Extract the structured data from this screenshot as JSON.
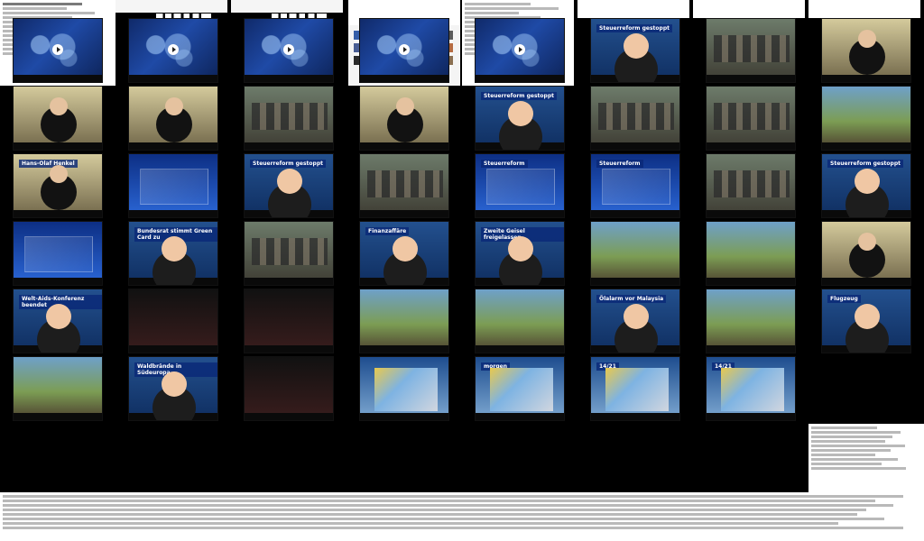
{
  "app": {
    "title": ""
  },
  "screen_panels": {
    "top_left_text": "",
    "top_mid_text": "",
    "top_right_text": "",
    "bottom_text": ""
  },
  "thumbnails": {
    "r1": [
      {
        "label": "",
        "type": "map"
      },
      {
        "label": "",
        "type": "map"
      },
      {
        "label": "",
        "type": "map"
      },
      {
        "label": "",
        "type": "map"
      },
      {
        "label": "",
        "type": "map"
      },
      {
        "label": "Steuerreform gestoppt",
        "type": "anchor"
      },
      {
        "label": "",
        "type": "meeting"
      },
      {
        "label": "",
        "type": "speaker"
      }
    ],
    "r2": [
      {
        "label": "",
        "type": "speaker"
      },
      {
        "label": "",
        "type": "speaker"
      },
      {
        "label": "",
        "type": "meeting"
      },
      {
        "label": "",
        "type": "speaker"
      },
      {
        "label": "Steuerreform gestoppt",
        "type": "anchor"
      },
      {
        "label": "",
        "type": "meeting"
      },
      {
        "label": "",
        "type": "meeting"
      },
      {
        "label": "",
        "type": "outdoor"
      }
    ],
    "r3": [
      {
        "label": "Hans-Olaf Henkel",
        "type": "speaker"
      },
      {
        "label": "",
        "type": "graphic"
      },
      {
        "label": "Steuerreform gestoppt",
        "type": "anchor"
      },
      {
        "label": "",
        "type": "meeting"
      },
      {
        "label": "Steuerreform",
        "type": "graphic"
      },
      {
        "label": "Steuerreform",
        "type": "graphic"
      },
      {
        "label": "",
        "type": "meeting"
      },
      {
        "label": "Steuerreform gestoppt",
        "type": "anchor"
      }
    ],
    "r4": [
      {
        "label": "",
        "type": "graphic"
      },
      {
        "label": "Bundesrat stimmt Green Card zu",
        "type": "anchor"
      },
      {
        "label": "",
        "type": "meeting"
      },
      {
        "label": "Finanzaffäre",
        "type": "anchor"
      },
      {
        "label": "Zweite Geisel freigelassen",
        "type": "anchor"
      },
      {
        "label": "",
        "type": "outdoor"
      },
      {
        "label": "",
        "type": "outdoor"
      },
      {
        "label": "",
        "type": "speaker"
      }
    ],
    "r5": [
      {
        "label": "Welt-Aids-Konferenz beendet",
        "type": "anchor"
      },
      {
        "label": "",
        "type": "dark"
      },
      {
        "label": "",
        "type": "dark"
      },
      {
        "label": "",
        "type": "outdoor"
      },
      {
        "label": "",
        "type": "outdoor"
      },
      {
        "label": "Ölalarm vor Malaysia",
        "type": "anchor"
      },
      {
        "label": "",
        "type": "outdoor"
      },
      {
        "label": "Flugzeug",
        "type": "anchor"
      }
    ],
    "r6": [
      {
        "label": "",
        "type": "outdoor"
      },
      {
        "label": "Waldbrände in Südeuropa",
        "type": "anchor"
      },
      {
        "label": "",
        "type": "dark"
      },
      {
        "label": "",
        "type": "weather"
      },
      {
        "label": "morgen",
        "type": "weather"
      },
      {
        "label": "14/21",
        "type": "weather"
      },
      {
        "label": "14/21",
        "type": "weather"
      }
    ]
  }
}
